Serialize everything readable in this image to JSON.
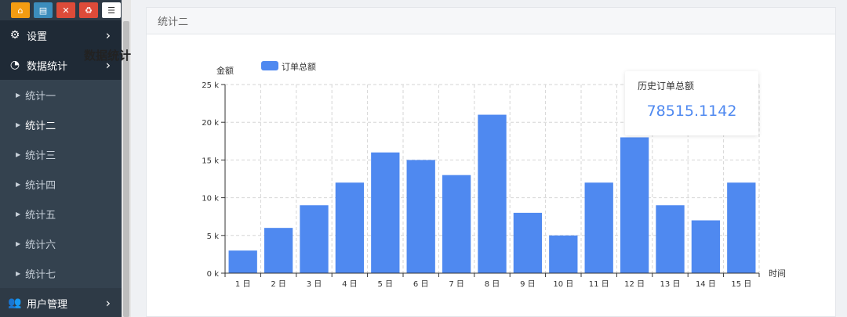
{
  "toolbar": {
    "buttons": [
      {
        "icon": "home-icon",
        "color": "#f39c12",
        "glyph": "⌂"
      },
      {
        "icon": "document-icon",
        "color": "#3c8dbc",
        "glyph": "▤"
      },
      {
        "icon": "trash-icon",
        "color": "#dd4b39",
        "glyph": "🗑"
      },
      {
        "icon": "recycle-icon",
        "color": "#dd4b39",
        "glyph": "♻"
      },
      {
        "icon": "list-icon",
        "color": "#ffffff",
        "glyph": "☰"
      }
    ]
  },
  "sidebar": {
    "settings_label": "设置",
    "stats_label": "数据统计",
    "users_label": "用户管理",
    "sub_items": [
      "统计一",
      "统计二",
      "统计三",
      "统计四",
      "统计五",
      "统计六",
      "统计七"
    ],
    "active_index": 1
  },
  "panel": {
    "title": "统计二"
  },
  "tooltip": {
    "title": "历史订单总额",
    "value": "78515.1142"
  },
  "colors": {
    "bar": "#4f89f0",
    "sidebar": "#2e3a46"
  },
  "chart_data": {
    "type": "bar",
    "title": "数据统计",
    "legend": [
      "订单总额"
    ],
    "ylabel": "金额",
    "xlabel": "时间",
    "categories": [
      "1 日",
      "2 日",
      "3 日",
      "4 日",
      "5 日",
      "6 日",
      "7 日",
      "8 日",
      "9 日",
      "10 日",
      "11 日",
      "12 日",
      "13 日",
      "14 日",
      "15 日"
    ],
    "series": [
      {
        "name": "订单总额",
        "values": [
          3000,
          6000,
          9000,
          12000,
          16000,
          15000,
          13000,
          21000,
          8000,
          5000,
          12000,
          18000,
          9000,
          7000,
          12000
        ]
      }
    ],
    "ylim": [
      0,
      25000
    ],
    "yticks": [
      {
        "value": 0,
        "label": "0 k"
      },
      {
        "value": 5000,
        "label": "5 k"
      },
      {
        "value": 10000,
        "label": "10 k"
      },
      {
        "value": 15000,
        "label": "15 k"
      },
      {
        "value": 20000,
        "label": "20 k"
      },
      {
        "value": 25000,
        "label": "25 k"
      }
    ],
    "grid": true,
    "legend_position": "top"
  }
}
